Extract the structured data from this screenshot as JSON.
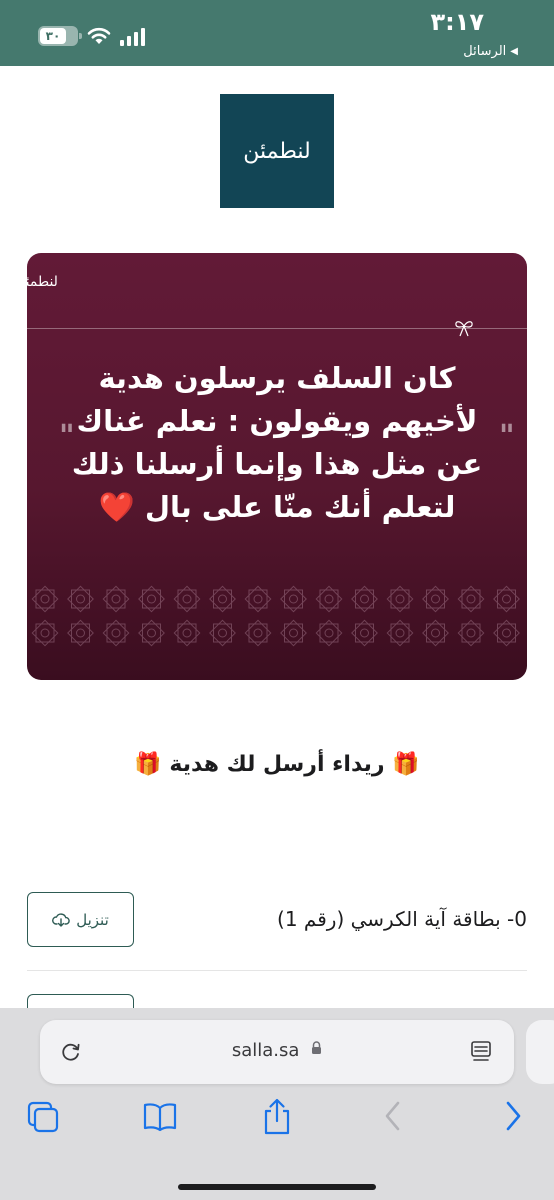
{
  "status_bar": {
    "time": "٣:١٧",
    "back_label": "الرسائل",
    "battery": "٣٠"
  },
  "logo": {
    "text": "لنطمئن"
  },
  "card": {
    "brand": "لنطمئن",
    "quote_lines": [
      "كان السلف يرسلون هدية",
      "لأخيهم ويقولون : نعلم غناك",
      "عن مثل هذا وإنما أرسلنا ذلك",
      "لتعلم أنك منّا على بال"
    ],
    "heart": "❤️",
    "open_quote": "\"",
    "close_quote": "\""
  },
  "gift_message": "🎁 ريداء أرسل لك هدية 🎁",
  "files": [
    {
      "name": "0- بطاقة آية الكرسي (رقم 1)",
      "button_label": "تنزيل"
    }
  ],
  "browser": {
    "url": "salla.sa"
  },
  "colors": {
    "status_bar": "#45796e",
    "logo_bg": "#124555",
    "card_bg": "#5c1833",
    "button_accent": "#2e5b54",
    "safari_blue": "#1a73e8"
  }
}
